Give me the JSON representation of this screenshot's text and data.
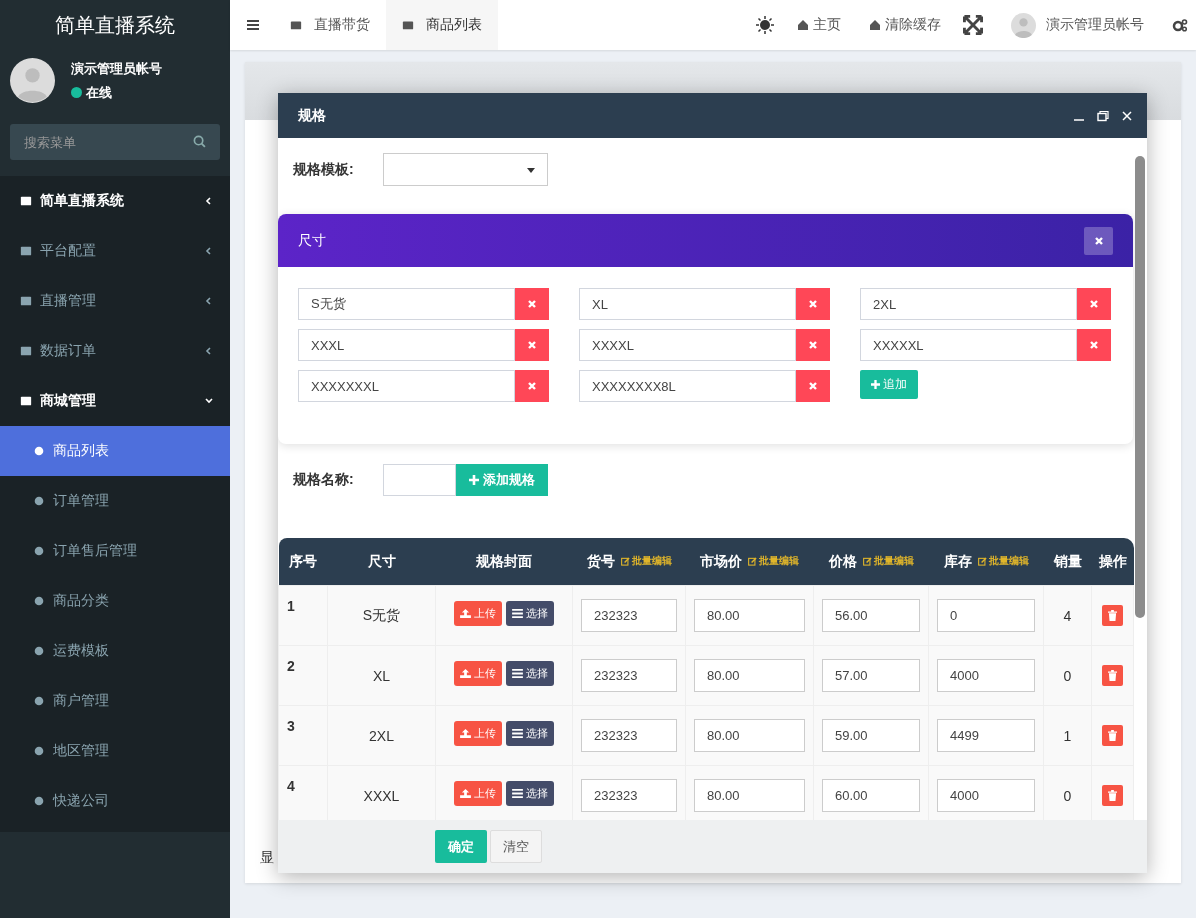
{
  "sidebar": {
    "brand": "简单直播系统",
    "user": {
      "name": "演示管理员帐号",
      "status": "在线"
    },
    "search": {
      "placeholder": "搜索菜单"
    },
    "menu": [
      {
        "label": "简单直播系统",
        "kind": "group",
        "expanded": false
      },
      {
        "label": "平台配置",
        "kind": "item",
        "expanded": false
      },
      {
        "label": "直播管理",
        "kind": "item",
        "expanded": false
      },
      {
        "label": "数据订单",
        "kind": "item",
        "expanded": false
      },
      {
        "label": "商城管理",
        "kind": "group",
        "expanded": true,
        "children": [
          {
            "label": "商品列表",
            "selected": true
          },
          {
            "label": "订单管理",
            "selected": false
          },
          {
            "label": "订单售后管理",
            "selected": false
          },
          {
            "label": "商品分类",
            "selected": false
          },
          {
            "label": "运费模板",
            "selected": false
          },
          {
            "label": "商户管理",
            "selected": false
          },
          {
            "label": "地区管理",
            "selected": false
          },
          {
            "label": "快递公司",
            "selected": false
          }
        ]
      }
    ]
  },
  "header": {
    "tabs": [
      {
        "label": "直播带货",
        "selected": false
      },
      {
        "label": "商品列表",
        "selected": true
      }
    ],
    "links": [
      "主页",
      "清除缓存"
    ],
    "user": "演示管理员帐号"
  },
  "background": {
    "footer_text": "显"
  },
  "dialog": {
    "title": "规格",
    "template": {
      "label": "规格模板:"
    },
    "spec_group": {
      "title": "尺寸",
      "values": [
        "S无货",
        "XL",
        "2XL",
        "XXXL",
        "XXXXL",
        "XXXXXL",
        "XXXXXXXL",
        "XXXXXXXX8L"
      ],
      "add_button": "追加"
    },
    "spec_name": {
      "label": "规格名称:",
      "button": "添加规格"
    },
    "table": {
      "columns": [
        {
          "label": "序号"
        },
        {
          "label": "尺寸"
        },
        {
          "label": "规格封面"
        },
        {
          "label": "货号",
          "action": "批量编辑"
        },
        {
          "label": "市场价",
          "action": "批量编辑"
        },
        {
          "label": "价格",
          "action": "批量编辑"
        },
        {
          "label": "库存",
          "action": "批量编辑"
        },
        {
          "label": "销量"
        },
        {
          "label": "操作"
        }
      ],
      "rows": [
        {
          "index": "1",
          "size": "S无货",
          "upload": "上传",
          "choose": "选择",
          "sku": "232323",
          "market_price": "80.00",
          "price": "56.00",
          "stock": "0",
          "sales": "4"
        },
        {
          "index": "2",
          "size": "XL",
          "upload": "上传",
          "choose": "选择",
          "sku": "232323",
          "market_price": "80.00",
          "price": "57.00",
          "stock": "4000",
          "sales": "0"
        },
        {
          "index": "3",
          "size": "2XL",
          "upload": "上传",
          "choose": "选择",
          "sku": "232323",
          "market_price": "80.00",
          "price": "59.00",
          "stock": "4499",
          "sales": "1"
        },
        {
          "index": "4",
          "size": "XXXL",
          "upload": "上传",
          "choose": "选择",
          "sku": "232323",
          "market_price": "80.00",
          "price": "60.00",
          "stock": "4000",
          "sales": "0"
        }
      ]
    },
    "buttons": [
      "确定",
      "清空"
    ]
  }
}
